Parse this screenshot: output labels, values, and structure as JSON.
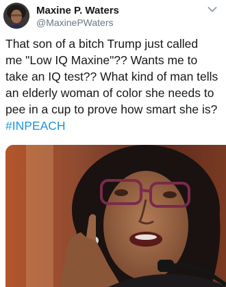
{
  "tweet": {
    "author": {
      "display_name": "Maxine P. Waters",
      "handle": "@MaxinePWaters",
      "avatar_icon": "profile-photo"
    },
    "menu_icon": "chevron-down-icon",
    "text": "That son of a bitch Trump just called\nme \"Low IQ Maxine\"?? Wants me to\ntake an IQ test?? What kind of man tells\nan elderly woman of color she needs to\npee in a cup to prove how smart she is?",
    "hashtag": "#INPEACH",
    "media": {
      "description": "photo"
    }
  },
  "colors": {
    "name": "#14171a",
    "handle": "#657786",
    "hashtag": "#1b95e0",
    "caret": "#8899a6"
  }
}
